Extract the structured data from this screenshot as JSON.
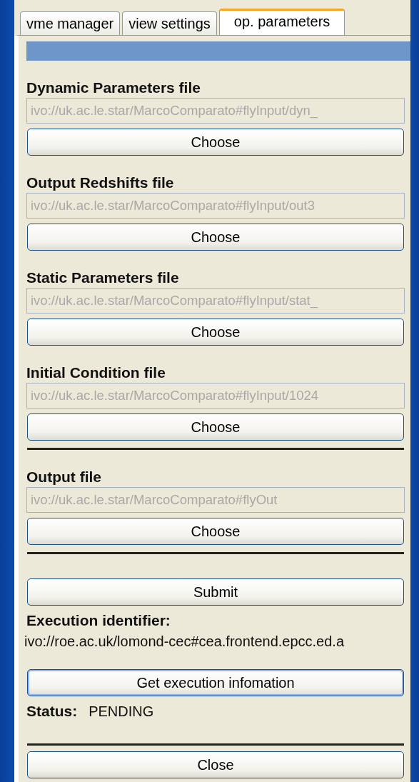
{
  "tabs": [
    {
      "label": "vme manager",
      "selected": false
    },
    {
      "label": "view settings",
      "selected": false
    },
    {
      "label": "op. parameters",
      "selected": true
    }
  ],
  "file_sections": [
    {
      "label": "Dynamic Parameters file",
      "field": {
        "value": "ivo://uk.ac.le.star/MarcoComparato#flyInput/dyn_",
        "disabled": true
      },
      "button": "Choose",
      "rule_after": false
    },
    {
      "label": "Output Redshifts file",
      "field": {
        "value": "ivo://uk.ac.le.star/MarcoComparato#flyInput/out3",
        "disabled": true
      },
      "button": "Choose",
      "rule_after": false
    },
    {
      "label": "Static Parameters file",
      "field": {
        "value": "ivo://uk.ac.le.star/MarcoComparato#flyInput/stat_",
        "disabled": true
      },
      "button": "Choose",
      "rule_after": false
    },
    {
      "label": "Initial Condition file",
      "field": {
        "value": "ivo://uk.ac.le.star/MarcoComparato#flyInput/1024",
        "disabled": true
      },
      "button": "Choose",
      "rule_after": true
    },
    {
      "label": "Output file",
      "field": {
        "value": "ivo://uk.ac.le.star/MarcoComparato#flyOut",
        "disabled": true
      },
      "button": "Choose",
      "rule_after": true
    }
  ],
  "submit_button": {
    "label": "Submit",
    "focused": false
  },
  "execution": {
    "label": "Execution identifier:",
    "value": "ivo://roe.ac.uk/lomond-cec#cea.frontend.epcc.ed.a"
  },
  "info_button": {
    "label": "Get execution infomation",
    "focused": true
  },
  "status": {
    "label": "Status:",
    "value": "PENDING"
  },
  "close_button": {
    "label": "Close",
    "focused": false
  }
}
